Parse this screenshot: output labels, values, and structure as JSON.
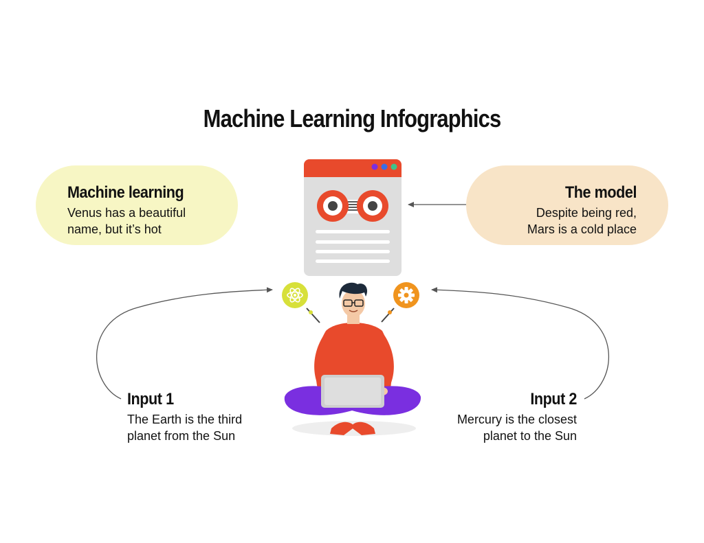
{
  "title": "Machine Learning Infographics",
  "blocks": {
    "machine_learning": {
      "heading": "Machine learning",
      "line1": "Venus has a beautiful",
      "line2": "name, but it’s hot"
    },
    "the_model": {
      "heading": "The model",
      "line1": "Despite being red,",
      "line2": "Mars is a cold place"
    },
    "input1": {
      "heading": "Input 1",
      "line1": "The Earth is the third",
      "line2": "planet from the Sun"
    },
    "input2": {
      "heading": "Input 2",
      "line1": "Mercury is the closest",
      "line2": "planet to the Sun"
    }
  },
  "colors": {
    "pill_left": "#f7f6c4",
    "pill_right": "#f8e4c7",
    "accent_red": "#e84a2c",
    "accent_purple": "#7a2fe0",
    "accent_yellow": "#d7e03a",
    "accent_orange": "#f0941e",
    "window_gray": "#dedede"
  },
  "icons": {
    "window": "browser-window-robot-icon",
    "left_bubble": "atom-icon",
    "right_bubble": "gear-icon"
  }
}
